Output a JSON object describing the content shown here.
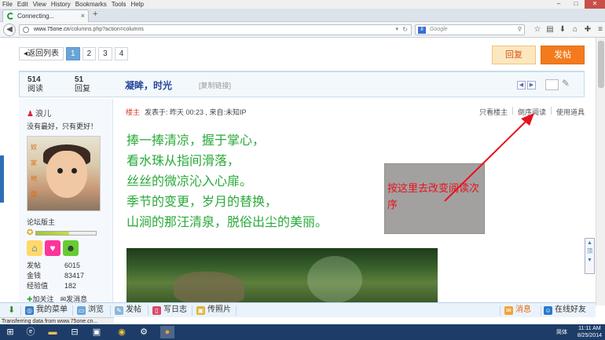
{
  "browser": {
    "menu": [
      "File",
      "Edit",
      "View",
      "History",
      "Bookmarks",
      "Tools",
      "Help"
    ],
    "tab_title": "Connecting...",
    "tab_close": "×",
    "new_tab": "+",
    "url_host": "www.75one.cn",
    "url_path": "/columns.php?action=columns",
    "search_engine": "8",
    "search_placeholder": "Google",
    "win_controls": [
      "–",
      "□",
      "✕"
    ],
    "status_text": "Transferring data from www.75one.cn..."
  },
  "pager": {
    "back_label": "返回列表",
    "pages": [
      "1",
      "2",
      "3",
      "4"
    ],
    "active_page": "1"
  },
  "actions": {
    "reply": "回复",
    "post": "发帖"
  },
  "thread": {
    "views_count": "514",
    "views_label": "阅读",
    "replies_count": "51",
    "replies_label": "回复",
    "title": "凝眸，时光",
    "copy_link": "[复制链接]"
  },
  "user": {
    "name": "浪儿",
    "motto": "没有最好，只有更好！",
    "avatar_text": [
      "奴",
      "家",
      "地",
      "盘"
    ],
    "role": "论坛版主",
    "level_progress": 0.55,
    "stats": [
      {
        "label": "发帖",
        "value": "6015"
      },
      {
        "label": "金钱",
        "value": "83417"
      },
      {
        "label": "经验值",
        "value": "182"
      }
    ],
    "follow": "加关注",
    "message": "发消息"
  },
  "post": {
    "floor": "楼主",
    "meta": "发表于: 昨天 00:23 , 来自:未知IP",
    "tools": [
      "只看楼主",
      "倒序阅读",
      "使用道具"
    ],
    "lines": [
      "捧一捧清凉，握于掌心，",
      "看水珠从指间滑落，",
      "丝丝的微凉沁入心扉。",
      "季节的变更，岁月的替换，",
      "山涧的那汪清泉，脱俗出尘的美丽。"
    ]
  },
  "annotation": {
    "note": "按这里去改变阅读次序",
    "arrow_color": "#e8111f"
  },
  "forum_bar": {
    "my_menu": "我的菜单",
    "browse": "浏览",
    "post": "发帖",
    "diary": "写日志",
    "photo": "传照片",
    "messages": "消息",
    "online_friends": "在线好友"
  },
  "taskbar": {
    "time": "11:11 AM",
    "date": "8/25/2014",
    "lang": "简体"
  },
  "colors": {
    "poem": "#2aa93a",
    "title": "#26479a",
    "post_button": "#f37b1d",
    "active_page": "#6aa5d8"
  }
}
